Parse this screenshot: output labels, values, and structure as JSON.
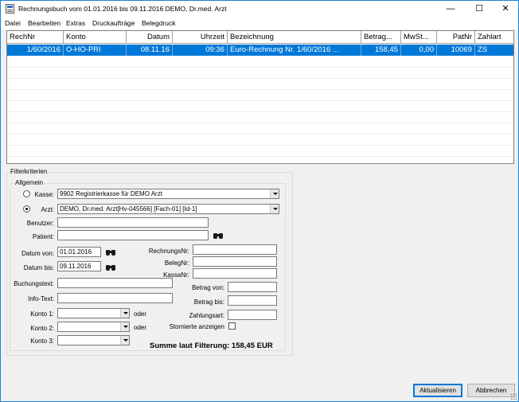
{
  "window": {
    "title": "Rechnungsbuch vom 01.01.2016 bis 09.11.2016 DEMO, Dr.med. Arzt",
    "controls": {
      "minimize": "—",
      "maximize": "☐",
      "close": "✕"
    }
  },
  "menu": [
    "Datei",
    "Bearbeiten",
    "Extras",
    "Druckaufträge",
    "Belegdruck"
  ],
  "grid": {
    "columns": [
      "RechNr",
      "Konto",
      "Datum",
      "Uhrzeit",
      "Bezeichnung",
      "Betrag...",
      "MwSt...",
      "PatNr",
      "Zahlart"
    ],
    "rows": [
      {
        "selected": true,
        "cells": [
          "1/60/2016",
          "O-HO-PRI",
          "08.11.16",
          "09:36",
          "Euro-Rechnung Nr. 1/60/2016 ...",
          "158,45",
          "0,00",
          "10069",
          "ZS"
        ]
      }
    ]
  },
  "filter": {
    "legend": "Filterkriterien",
    "allgemein_legend": "Allgemein",
    "kasse_label": "Kasse:",
    "kasse_value": "9902  Registrierkasse für DEMO Arzt",
    "kasse_selected": false,
    "arzt_label": "Arzt:",
    "arzt_value": "DEMO, Dr.med. Arzt[Hv-045566] [Fach-01] [Id-1]",
    "arzt_selected": true,
    "benutzer_label": "Benutzer:",
    "benutzer_value": "",
    "patient_label": "Patient:",
    "patient_value": "",
    "datum_von_label": "Datum von:",
    "datum_von_value": "01.01.2016",
    "datum_bis_label": "Datum bis:",
    "datum_bis_value": "09.11.2016",
    "rechnungsnr_label": "RechnungsNr:",
    "rechnungsnr_value": "",
    "belegnr_label": "BelegNr:",
    "belegnr_value": "",
    "kassanr_label": "KassaNr:",
    "kassanr_value": "",
    "buchungstext_label": "Buchungstext:",
    "buchungstext_value": "",
    "info_text_label": "Info-Text:",
    "info_text_value": "",
    "betrag_von_label": "Betrag von:",
    "betrag_von_value": "",
    "betrag_bis_label": "Betrag bis:",
    "betrag_bis_value": "",
    "zahlungsart_label": "Zahlungsart:",
    "zahlungsart_value": "",
    "konto1_label": "Konto 1:",
    "konto1_value": "",
    "konto2_label": "Konto 2:",
    "konto2_value": "",
    "konto3_label": "Konto 3:",
    "konto3_value": "",
    "oder_label": "oder",
    "stornierte_label": "Stornierte anzeigen",
    "stornierte_checked": false,
    "summe_text": "Summe laut Filterung: 158,45 EUR"
  },
  "buttons": {
    "aktualisieren": "Aktualisieren",
    "abbrechen": "Abbrechen"
  },
  "icons": {
    "app": "ledger-icon",
    "search": "binoculars-icon"
  },
  "colors": {
    "selection": "#0078d7",
    "window_border": "#1883d7"
  }
}
